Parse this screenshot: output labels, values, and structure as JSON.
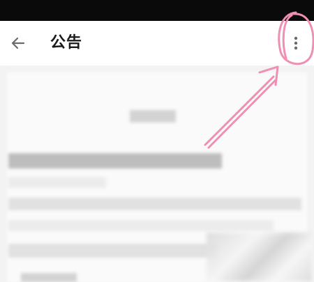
{
  "app_bar": {
    "title": "公告",
    "back_icon": "arrow-back-icon",
    "more_icon": "more-vertical-icon"
  },
  "colors": {
    "status_bar": "#0a0a0a",
    "app_bar_bg": "#ffffff",
    "icon": "#6b6b6b",
    "annotation": "#ef8fb4"
  }
}
